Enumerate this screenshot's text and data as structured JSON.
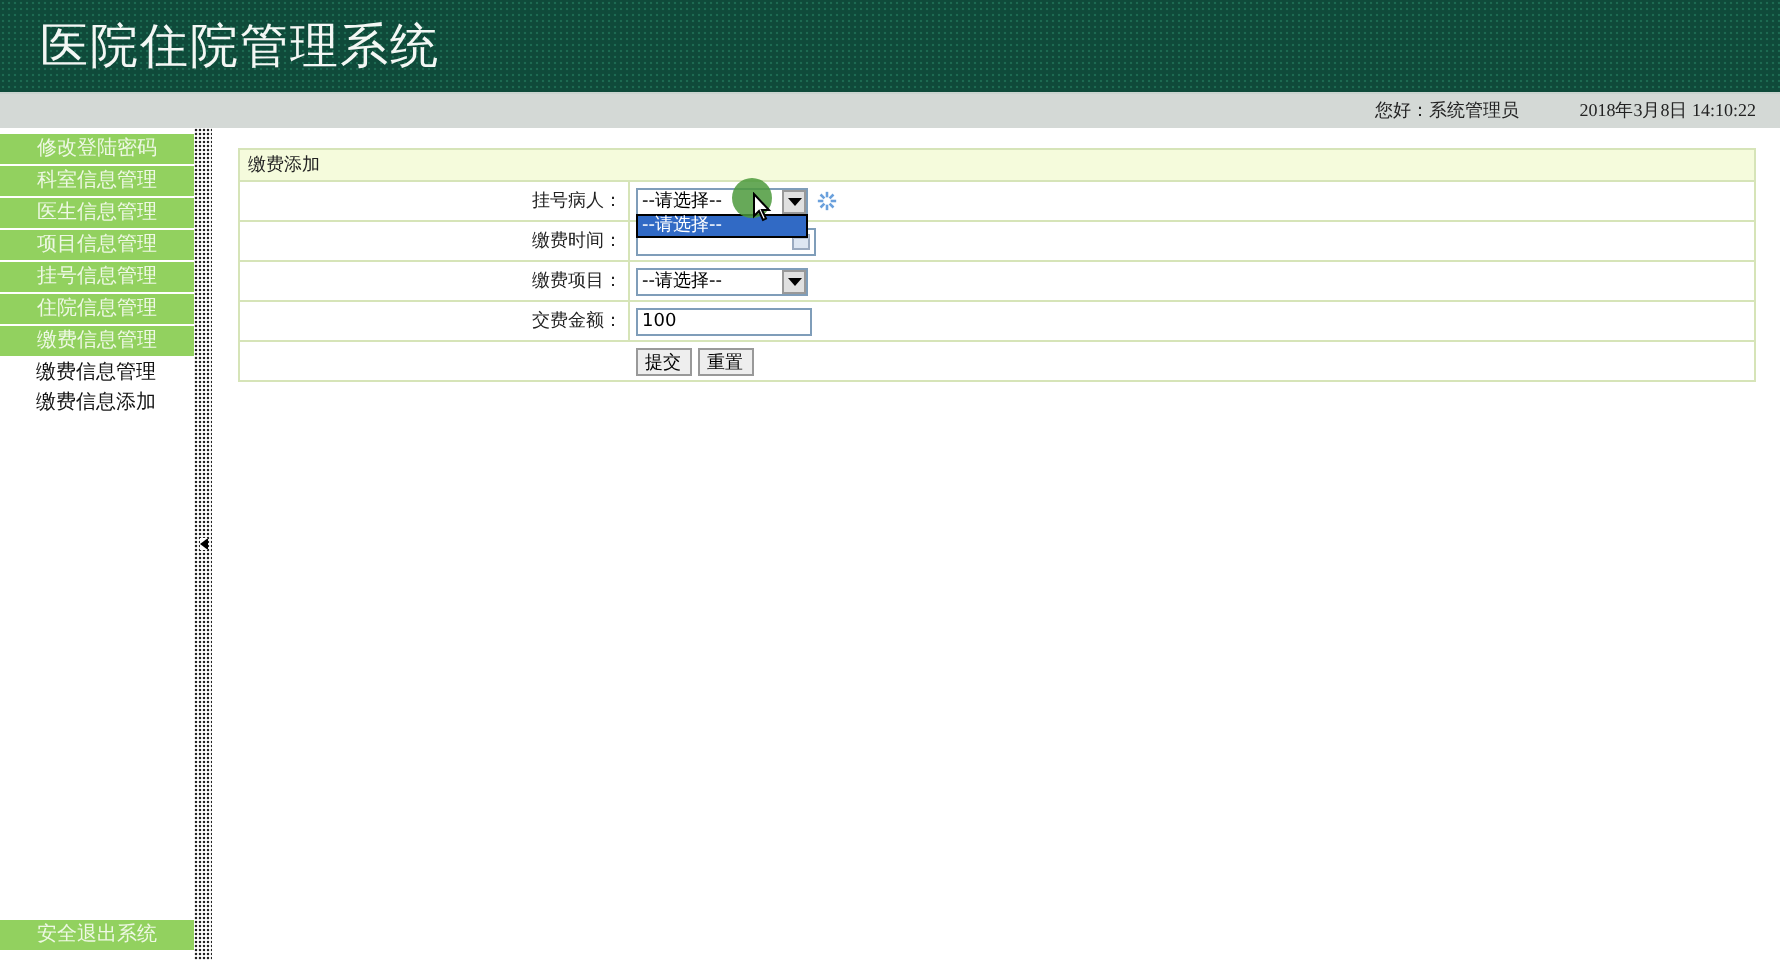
{
  "header": {
    "title": "医院住院管理系统"
  },
  "status_bar": {
    "greeting": "您好：系统管理员",
    "datetime": "2018年3月8日  14:10:22"
  },
  "sidebar": {
    "items": [
      {
        "label": "修改登陆密码"
      },
      {
        "label": "科室信息管理"
      },
      {
        "label": "医生信息管理"
      },
      {
        "label": "项目信息管理"
      },
      {
        "label": "挂号信息管理"
      },
      {
        "label": "住院信息管理"
      },
      {
        "label": "缴费信息管理",
        "children": [
          {
            "label": "缴费信息管理"
          },
          {
            "label": "缴费信息添加"
          }
        ]
      }
    ],
    "logout": "安全退出系统"
  },
  "form": {
    "title": "缴费添加",
    "fields": [
      {
        "kind": "select",
        "label": "挂号病人：",
        "value": "--请选择--",
        "open": true,
        "options": [
          {
            "label": "--请选择--",
            "selected": true
          }
        ],
        "loading": true
      },
      {
        "kind": "date",
        "label": "缴费时间："
      },
      {
        "kind": "select",
        "label": "缴费项目：",
        "value": "--请选择--",
        "open": false
      },
      {
        "kind": "text",
        "label": "交费金额：",
        "value": "100"
      }
    ],
    "buttons": [
      "提交",
      "重置"
    ]
  }
}
